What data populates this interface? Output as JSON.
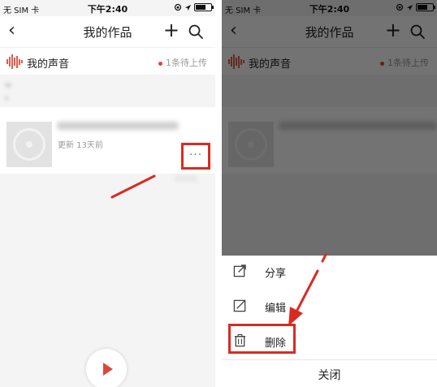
{
  "status_bar": {
    "carrier": "无 SIM 卡",
    "time": "下午2:40"
  },
  "nav": {
    "title": "我的作品"
  },
  "voice_row": {
    "label": "我的声音",
    "pending": "1条待上传"
  },
  "work_item": {
    "meta": "更新 13天前",
    "more": "···"
  },
  "sheet": {
    "share": "分享",
    "edit": "编辑",
    "delete": "删除",
    "close": "关闭"
  },
  "colors": {
    "accent_red": "#d92b22",
    "wave_red": "#e05a4e",
    "overlay": "rgba(0,0,0,0.55)"
  }
}
